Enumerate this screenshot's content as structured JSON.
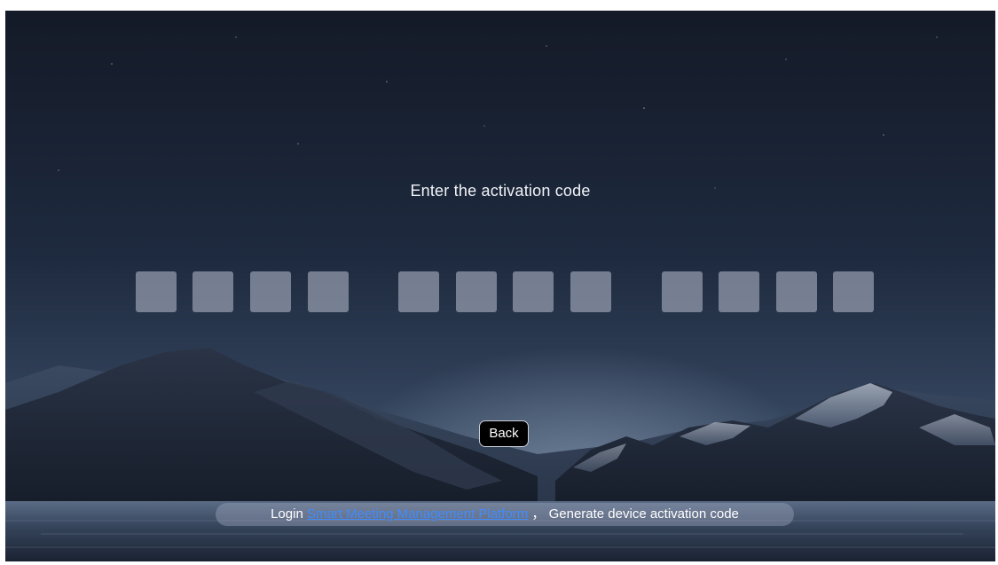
{
  "screen": {
    "prompt": "Enter the activation code",
    "back_label": "Back"
  },
  "activation_code": {
    "groups": [
      [
        "",
        "",
        "",
        ""
      ],
      [
        "",
        "",
        "",
        ""
      ],
      [
        "",
        "",
        "",
        ""
      ]
    ]
  },
  "hint": {
    "prefix": "Login ",
    "link_text": "Smart Meeting Management Platform",
    "separator": " ，",
    "suffix": " Generate device activation code"
  },
  "colors": {
    "link": "#3f8cff",
    "box": "#969eaf"
  }
}
